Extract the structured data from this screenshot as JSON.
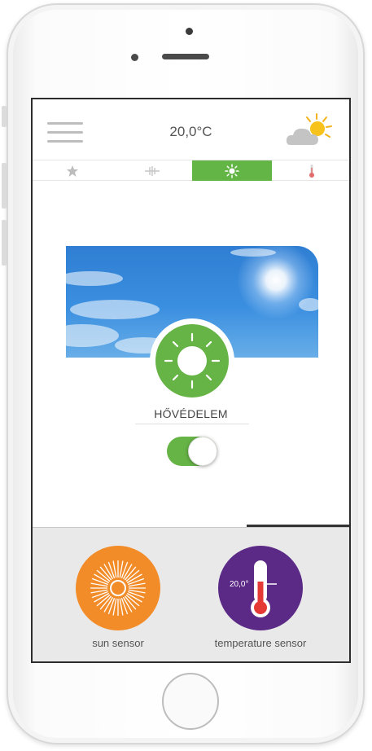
{
  "header": {
    "temperature": "20,0°C",
    "weather_icon": "partly-sunny-icon"
  },
  "tabs": [
    {
      "icon": "star-icon",
      "active": false
    },
    {
      "icon": "wind-icon",
      "active": false
    },
    {
      "icon": "sun-icon",
      "active": true
    },
    {
      "icon": "thermometer-icon",
      "active": false
    }
  ],
  "main": {
    "label": "HŐVÉDELEM",
    "toggle_on": true
  },
  "sensors": [
    {
      "label": "sun sensor",
      "icon": "sun-burst-icon",
      "color": "#f28c28"
    },
    {
      "label": "temperature sensor",
      "icon": "thermometer-icon",
      "color": "#5b2a86",
      "reading": "20,0°"
    }
  ],
  "colors": {
    "accent_green": "#63b545",
    "sun_orange": "#f28c28",
    "temp_purple": "#5b2a86",
    "thermo_red": "#e53935"
  }
}
